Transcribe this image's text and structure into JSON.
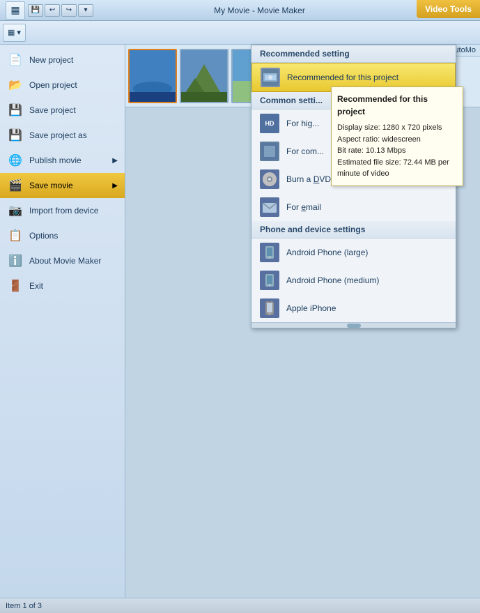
{
  "titleBar": {
    "title": "My Movie - Movie Maker",
    "buttons": [
      "─",
      "□",
      "✕"
    ]
  },
  "videoToolsBadge": "Video Tools",
  "toolbar": {
    "dropdownLabel": "▼",
    "buttons": [
      "◄",
      "►",
      "↩",
      "↪"
    ]
  },
  "leftMenu": {
    "items": [
      {
        "id": "new-project",
        "icon": "📄",
        "label": "New project",
        "arrow": false
      },
      {
        "id": "open-project",
        "icon": "📂",
        "label": "Open project",
        "arrow": false
      },
      {
        "id": "save-project",
        "icon": "💾",
        "label": "Save project",
        "arrow": false
      },
      {
        "id": "save-project-as",
        "icon": "💾",
        "label": "Save project as",
        "arrow": false
      },
      {
        "id": "publish-movie",
        "icon": "🌐",
        "label": "Publish movie",
        "arrow": true
      },
      {
        "id": "save-movie",
        "icon": "🎬",
        "label": "Save movie",
        "arrow": true,
        "active": true
      },
      {
        "id": "import-from-device",
        "icon": "📷",
        "label": "Import from device",
        "arrow": false
      },
      {
        "id": "options",
        "icon": "📋",
        "label": "Options",
        "arrow": false
      },
      {
        "id": "about",
        "icon": "ℹ️",
        "label": "About Movie Maker",
        "arrow": false
      },
      {
        "id": "exit",
        "icon": "🚪",
        "label": "Exit",
        "arrow": false
      }
    ]
  },
  "dropdown": {
    "recommendedSection": {
      "header": "Recommended setting",
      "items": [
        {
          "id": "recommended-this-project",
          "label": "Recommended for this project",
          "highlighted": true
        }
      ]
    },
    "commonSection": {
      "header": "Common setti...",
      "items": [
        {
          "id": "for-high",
          "label": "For hig...",
          "iconText": "HD"
        },
        {
          "id": "for-com",
          "label": "For com...",
          "iconText": "📱"
        },
        {
          "id": "burn-dvd",
          "label": "Burn a DVD",
          "iconText": "💿"
        },
        {
          "id": "for-email",
          "label": "For email",
          "iconText": "✉"
        }
      ]
    },
    "phoneSection": {
      "header": "Phone and device settings",
      "items": [
        {
          "id": "android-large",
          "label": "Android Phone (large)",
          "iconText": "📱"
        },
        {
          "id": "android-medium",
          "label": "Android Phone (medium)",
          "iconText": "📱"
        },
        {
          "id": "apple-iphone",
          "label": "Apple iPhone",
          "iconText": "📱"
        }
      ]
    }
  },
  "tooltip": {
    "title": "Recommended for this project",
    "lines": [
      "Display size: 1280 x 720 pixels",
      "Aspect ratio: widescreen",
      "Bit rate: 10.13 Mbps",
      "Estimated file size: 72.44 MB per minute of video"
    ]
  },
  "autoMoLabel": "AutoMo",
  "statusBar": {
    "text": "Item 1 of 3"
  }
}
